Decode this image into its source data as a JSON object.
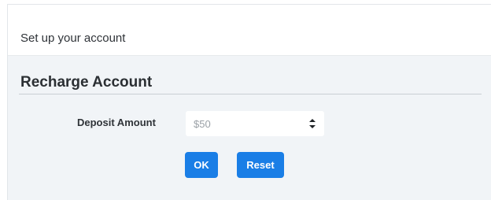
{
  "header": {
    "title": "Set up your account"
  },
  "section": {
    "title": "Recharge Account"
  },
  "form": {
    "deposit_label": "Deposit Amount",
    "deposit_value": "$50"
  },
  "buttons": {
    "ok_label": "OK",
    "reset_label": "Reset"
  },
  "icons": {
    "select_arrows": "up-down-chevron-icon"
  },
  "colors": {
    "accent": "#1a7ee6",
    "panel_background": "#f1f4f7"
  }
}
